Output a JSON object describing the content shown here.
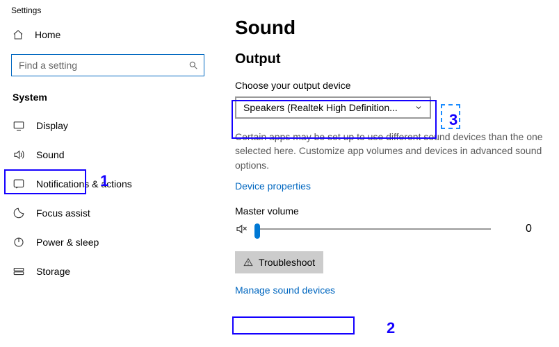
{
  "window_title": "Settings",
  "sidebar": {
    "home": "Home",
    "search_placeholder": "Find a setting",
    "group_heading": "System",
    "items": [
      {
        "label": "Display"
      },
      {
        "label": "Sound"
      },
      {
        "label": "Notifications & actions"
      },
      {
        "label": "Focus assist"
      },
      {
        "label": "Power & sleep"
      },
      {
        "label": "Storage"
      }
    ]
  },
  "main": {
    "title": "Sound",
    "output_heading": "Output",
    "output_label": "Choose your output device",
    "output_device": "Speakers (Realtek High Definition...",
    "output_description": "Certain apps may be set up to use different sound devices than the one selected here. Customize app volumes and devices in advanced sound options.",
    "device_properties": "Device properties",
    "master_volume_label": "Master volume",
    "master_volume_value": "0",
    "troubleshoot": "Troubleshoot",
    "manage": "Manage sound devices"
  },
  "annotations": {
    "marker1": "1",
    "marker2": "2",
    "marker3": "3"
  }
}
